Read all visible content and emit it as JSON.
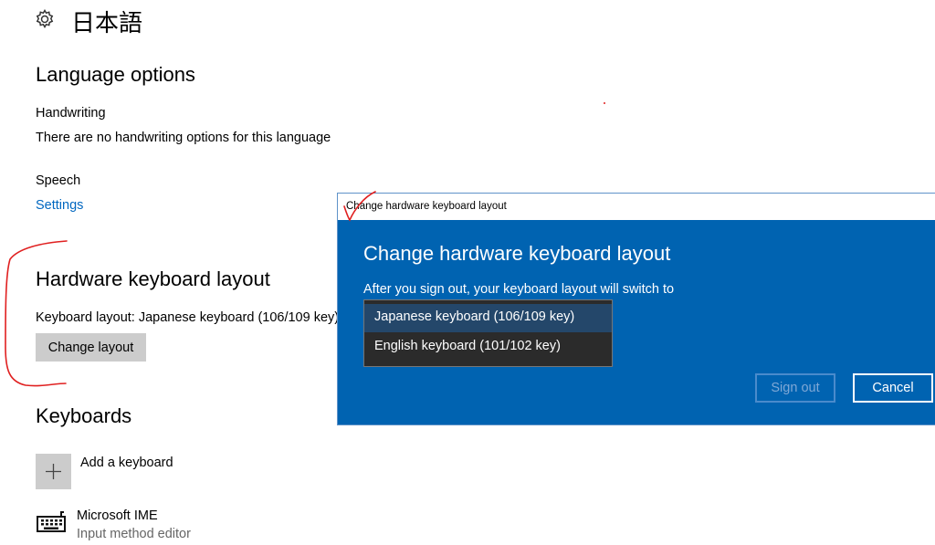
{
  "header": {
    "title": "日本語",
    "icon": "gear-icon"
  },
  "language_options": {
    "heading": "Language options",
    "handwriting_label": "Handwriting",
    "handwriting_text": "There are no handwriting options for this language",
    "speech_label": "Speech",
    "speech_link": "Settings"
  },
  "hardware_keyboard": {
    "heading": "Hardware keyboard layout",
    "layout_text": "Keyboard layout:  Japanese keyboard (106/109 key)",
    "change_button": "Change layout"
  },
  "keyboards": {
    "heading": "Keyboards",
    "add_label": "Add a keyboard",
    "ime_name": "Microsoft IME",
    "ime_desc": "Input method editor"
  },
  "dialog": {
    "titlebar": "Change hardware keyboard layout",
    "heading": "Change hardware keyboard layout",
    "description": "After you sign out, your keyboard layout will switch to",
    "options": [
      {
        "label": "Japanese keyboard (106/109 key)"
      },
      {
        "label": "English keyboard (101/102 key)"
      }
    ],
    "sign_out": "Sign out",
    "cancel": "Cancel"
  },
  "colors": {
    "dialog_bg": "#0063b1",
    "link": "#0067c0",
    "annotation": "#e02020"
  }
}
